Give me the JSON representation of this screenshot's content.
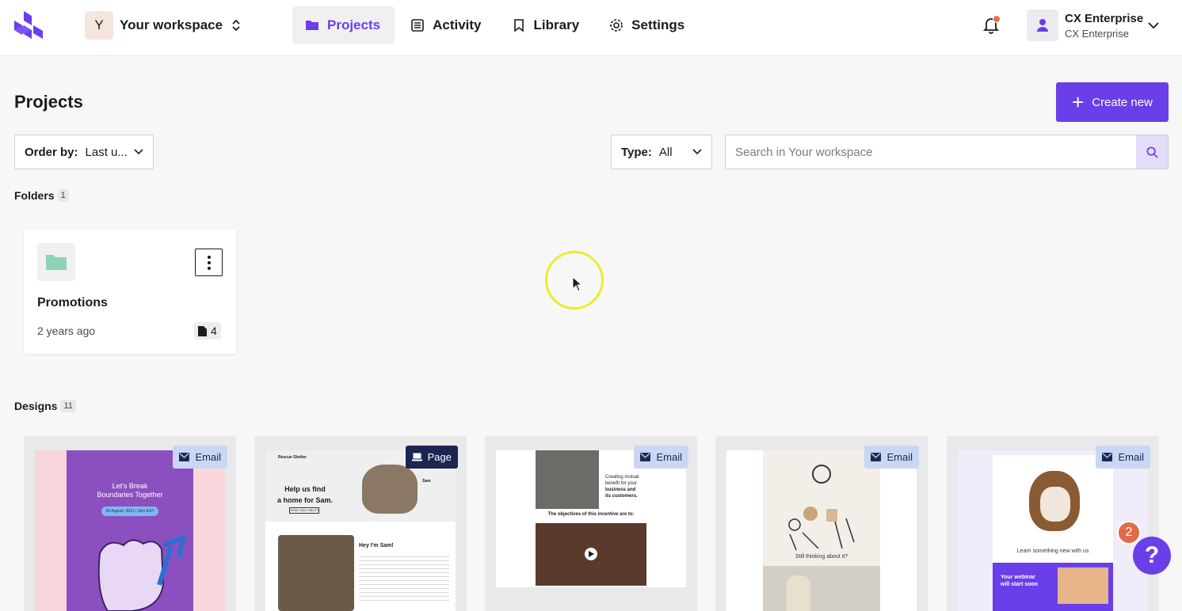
{
  "workspace": {
    "initial": "Y",
    "name": "Your workspace"
  },
  "nav": {
    "projects": "Projects",
    "activity": "Activity",
    "library": "Library",
    "settings": "Settings"
  },
  "user": {
    "name": "CX Enterprise",
    "org": "CX Enterprise"
  },
  "page": {
    "title": "Projects",
    "create_label": "Create new"
  },
  "filters": {
    "order_label": "Order by:",
    "order_value": "Last u...",
    "type_label": "Type:",
    "type_value": "All",
    "search_placeholder": "Search in Your workspace"
  },
  "folders": {
    "label": "Folders",
    "count": "1",
    "items": [
      {
        "name": "Promotions",
        "date": "2 years ago",
        "count": "4"
      }
    ]
  },
  "designs": {
    "label": "Designs",
    "count": "11",
    "items": [
      {
        "type": "Email",
        "thumb_text": [
          "Let's Break",
          "Boundaries Together",
          "26 August, 2021 | 2pm EST"
        ]
      },
      {
        "type": "Page",
        "thumb_text": [
          "Rescue Shelter",
          "Help us find",
          "a home for Sam.",
          "Sam",
          "Hey I'm Sam!",
          "HOW CAN I HELP?"
        ]
      },
      {
        "type": "Email",
        "thumb_text": [
          "Creating mutual",
          "benefit for your",
          "business and",
          "its customers.",
          "The objectives of this incentive are to:"
        ]
      },
      {
        "type": "Email",
        "thumb_text": [
          "Still thinking about it?"
        ]
      },
      {
        "type": "Email",
        "thumb_text": [
          "Learn something new with us",
          "Your webinar",
          "will start soon"
        ]
      }
    ]
  },
  "help": {
    "badge": "2",
    "symbol": "?"
  },
  "colors": {
    "accent": "#6a3ee8",
    "notification": "#e8704a",
    "email_badge": "#c9d7f3",
    "page_badge": "#1c2452"
  }
}
